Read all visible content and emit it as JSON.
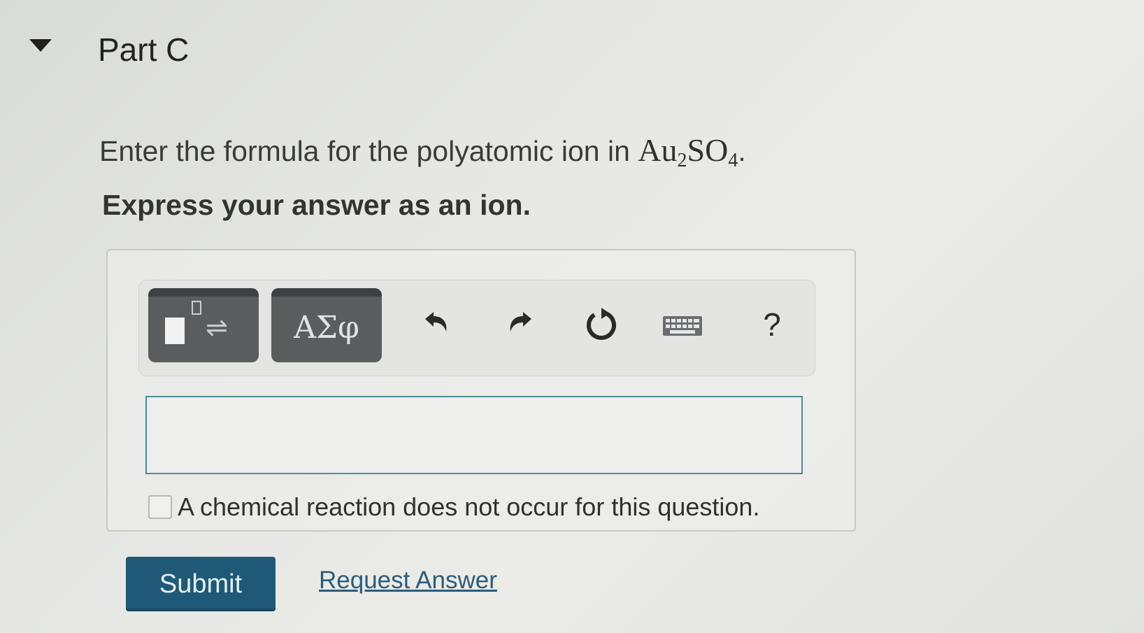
{
  "part": {
    "title": "Part C"
  },
  "question": {
    "prompt_text": "Enter the formula for the polyatomic ion in ",
    "formula_main1": "Au",
    "formula_sub1": "2",
    "formula_main2": "SO",
    "formula_sub2": "4",
    "formula_tail": ".",
    "instruction": "Express your answer as an ion."
  },
  "toolbar": {
    "greek_label": "ΑΣφ",
    "help_label": "?",
    "template_arrows": "⇌"
  },
  "answer": {
    "value": "",
    "placeholder": ""
  },
  "no_reaction": {
    "label": "A chemical reaction does not occur for this question.",
    "checked": false
  },
  "actions": {
    "submit_label": "Submit",
    "request_answer_label": "Request Answer"
  },
  "icons": {
    "collapse": "triangle-down-icon",
    "undo": "undo-arrow-icon",
    "redo": "redo-arrow-icon",
    "reset": "reset-circular-arrow-icon",
    "keyboard": "keyboard-icon"
  },
  "colors": {
    "submit_bg": "#1e5a78",
    "input_border": "#4c8d98",
    "link": "#2d5c7a",
    "tool_button_bg": "#5a5c5e"
  }
}
